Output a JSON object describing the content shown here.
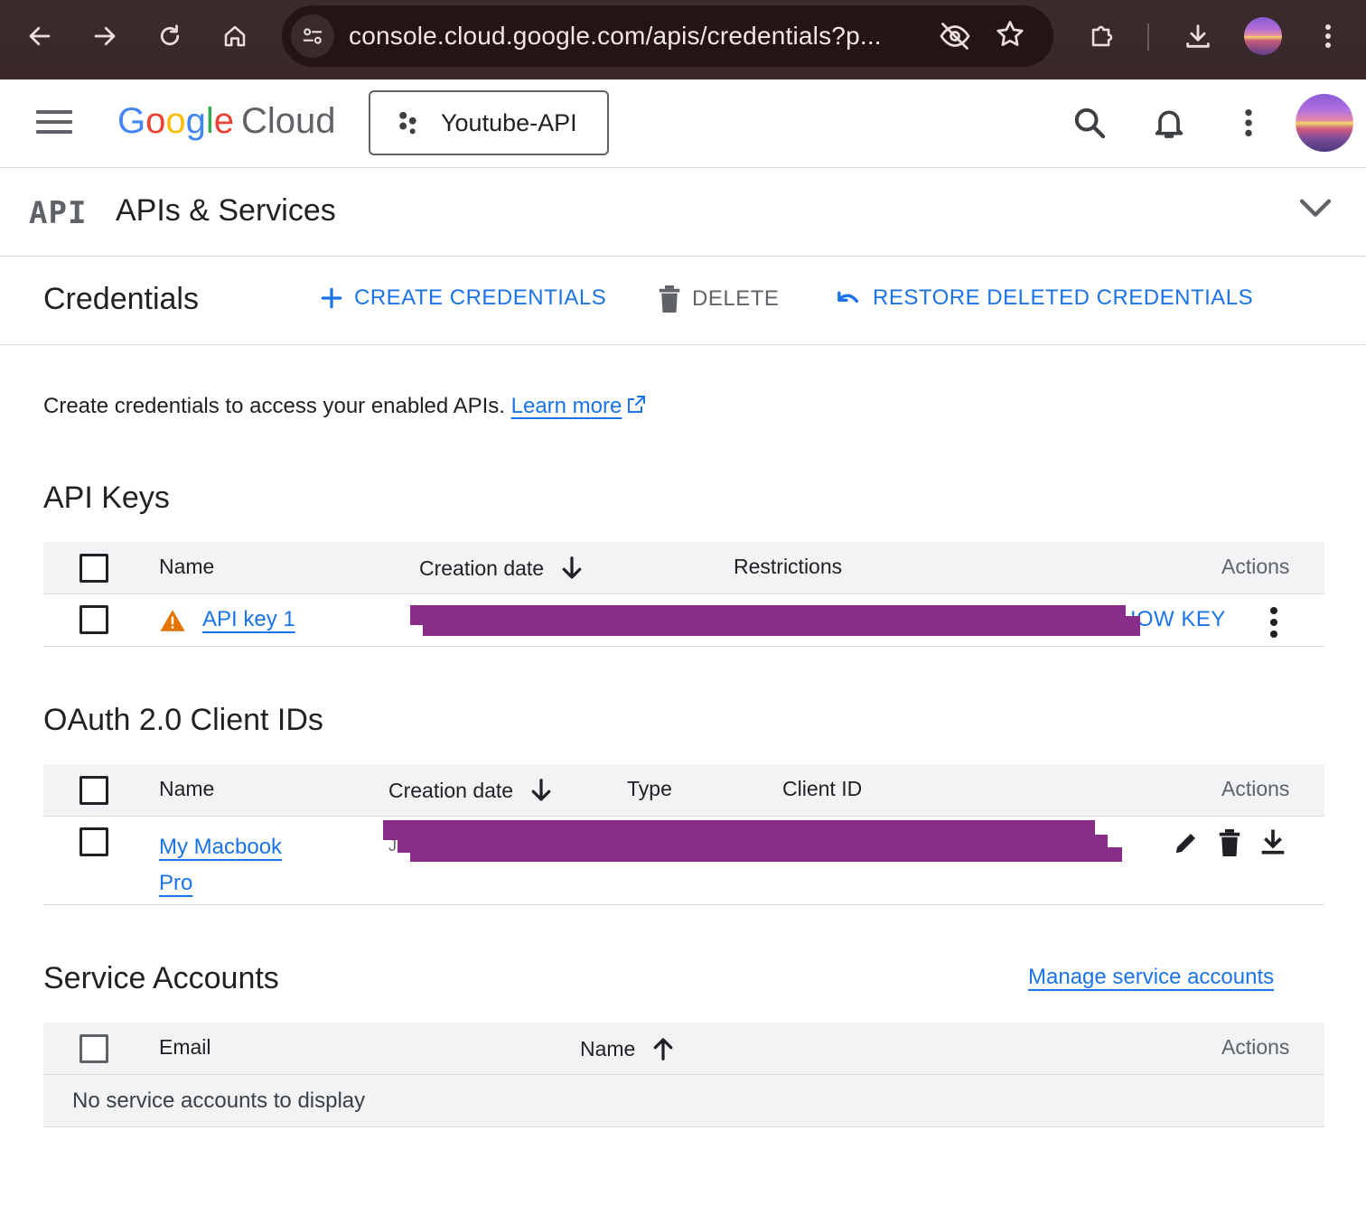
{
  "browser": {
    "url": "console.cloud.google.com/apis/credentials?p..."
  },
  "appbar": {
    "logo_letters": [
      "G",
      "o",
      "o",
      "g",
      "l",
      "e"
    ],
    "logo_suffix": "Cloud",
    "project": "Youtube-API"
  },
  "section": {
    "glyph": "API",
    "title": "APIs & Services"
  },
  "toolbar": {
    "title": "Credentials",
    "create_label": "CREATE CREDENTIALS",
    "delete_label": "DELETE",
    "restore_label": "RESTORE DELETED CREDENTIALS"
  },
  "intro": {
    "text": "Create credentials to access your enabled APIs.",
    "learn_more": "Learn more"
  },
  "api_keys": {
    "heading": "API Keys",
    "columns": {
      "name": "Name",
      "created": "Creation date",
      "restrictions": "Restrictions",
      "actions": "Actions"
    },
    "rows": [
      {
        "name": "API key 1",
        "action": "HOW KEY"
      }
    ]
  },
  "oauth": {
    "heading": "OAuth 2.0 Client IDs",
    "columns": {
      "name": "Name",
      "created": "Creation date",
      "type": "Type",
      "client_id": "Client ID",
      "actions": "Actions"
    },
    "rows": [
      {
        "name_line1": "My Macbook",
        "name_line2": "Pro",
        "client_id_fragment": "J"
      }
    ]
  },
  "service_accounts": {
    "heading": "Service Accounts",
    "manage_link": "Manage service accounts",
    "columns": {
      "email": "Email",
      "name": "Name",
      "actions": "Actions"
    },
    "empty_text": "No service accounts to display"
  },
  "colors": {
    "accent": "#1a73e8",
    "redaction": "#882d8a",
    "warning": "#e37400",
    "chrome": "#3b2b2c"
  }
}
